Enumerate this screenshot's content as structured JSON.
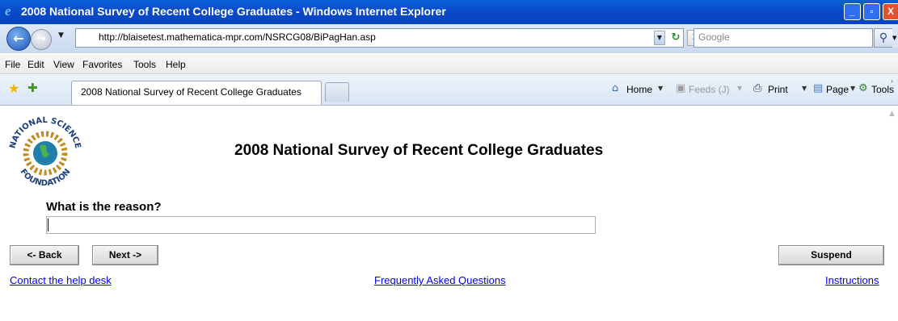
{
  "window": {
    "title": "2008 National Survey of Recent College Graduates - Windows Internet Explorer",
    "controls": {
      "minimize": "_",
      "maximize": "▫",
      "close": "X"
    }
  },
  "address_bar": {
    "url": "http://blaisetest.mathematica-mpr.com/NSRCG08/BiPagHan.asp",
    "search_placeholder": "Google"
  },
  "menu": [
    "File",
    "Edit",
    "View",
    "Favorites",
    "Tools",
    "Help"
  ],
  "tab": {
    "label": "2008 National Survey of Recent College Graduates"
  },
  "command_bar": {
    "home": "Home",
    "feeds": "Feeds (J)",
    "print": "Print",
    "page": "Page",
    "tools": "Tools"
  },
  "logo": {
    "top_text": "NATIONAL  SCIENCE",
    "bottom_text": "FOUNDATION"
  },
  "survey": {
    "title": "2008 National Survey of Recent College Graduates",
    "question": "What is the reason?",
    "answer_value": ""
  },
  "buttons": {
    "back": "<- Back",
    "next": "Next ->",
    "suspend": "Suspend"
  },
  "links": {
    "help_desk": "Contact the help desk",
    "faq": "Frequently Asked Questions",
    "instructions": "Instructions"
  },
  "icons": {
    "ie": "ie-logo-icon",
    "back": "back-arrow-icon",
    "forward": "forward-arrow-icon",
    "refresh": "refresh-icon",
    "stop": "stop-icon",
    "search": "search-icon",
    "favorites": "favorites-star-icon",
    "add_favorites": "add-favorites-icon",
    "home": "home-icon",
    "feeds": "feeds-icon",
    "print": "printer-icon",
    "page": "page-icon",
    "tools": "gear-icon"
  },
  "colors": {
    "titlebar": "#0a52d0",
    "link": "#0000ee",
    "close_button": "#e2502c"
  }
}
